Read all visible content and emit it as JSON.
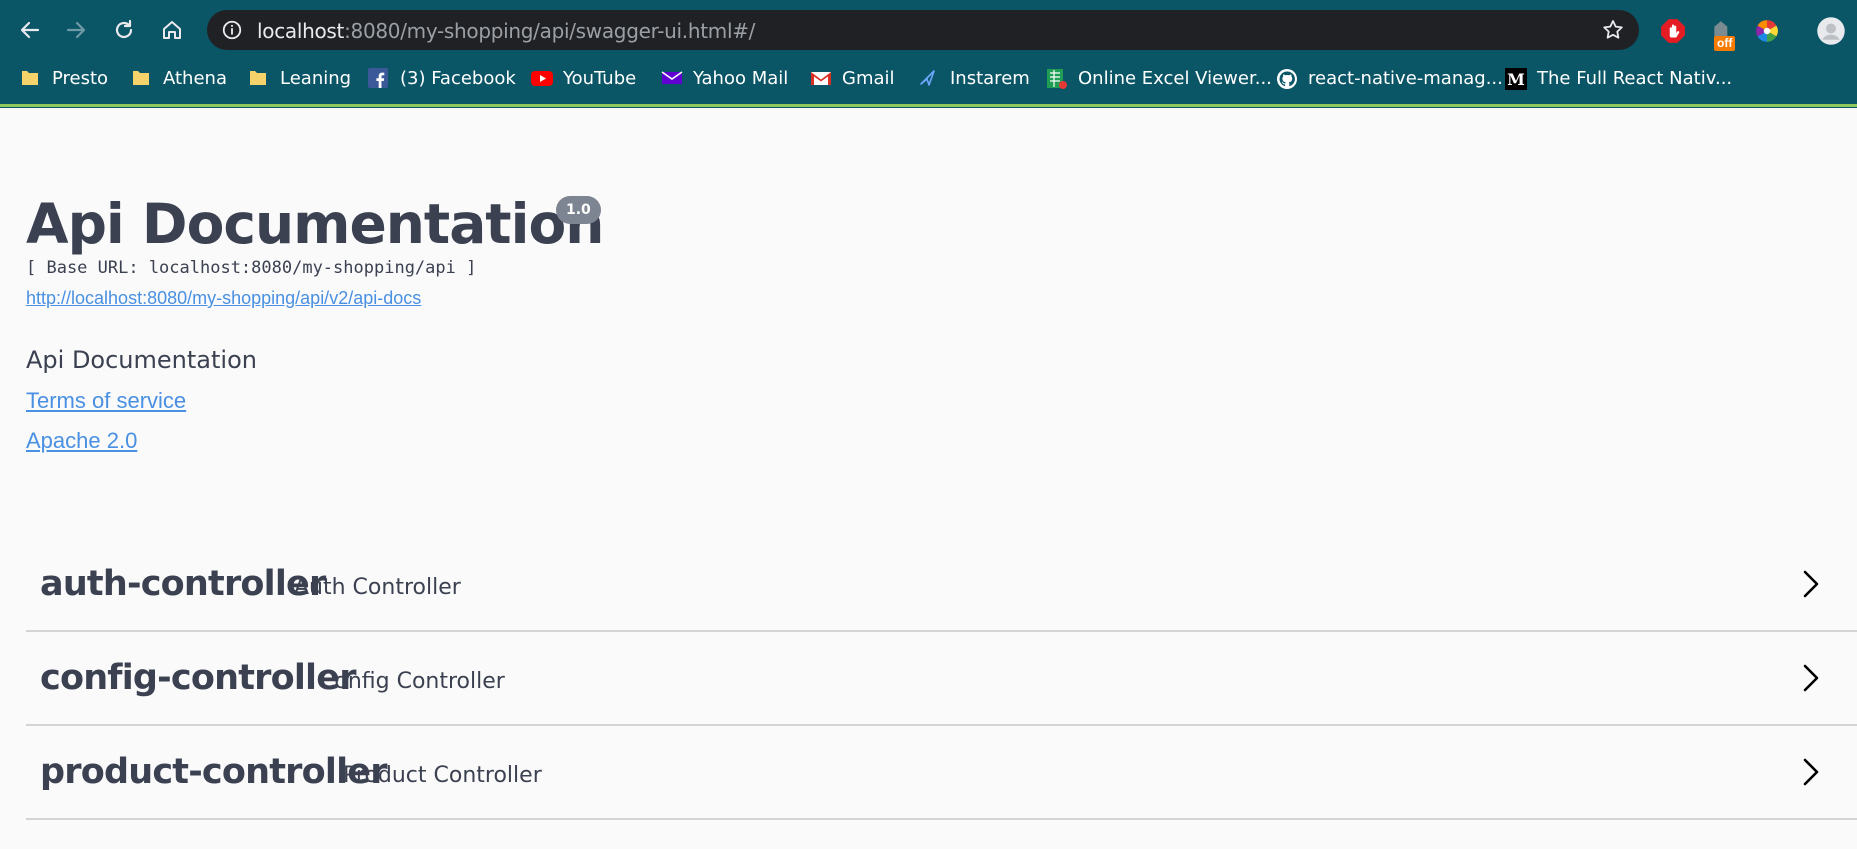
{
  "browser": {
    "url_host": "localhost",
    "url_rest": ":8080/my-shopping/api/swagger-ui.html#/",
    "extension_badge": "off",
    "bookmarks": [
      {
        "label": "Presto",
        "icon": "folder-icon"
      },
      {
        "label": "Athena",
        "icon": "folder-icon"
      },
      {
        "label": "Leaning",
        "icon": "folder-icon"
      },
      {
        "label": "(3) Facebook",
        "icon": "facebook-icon"
      },
      {
        "label": "YouTube",
        "icon": "youtube-icon"
      },
      {
        "label": "Yahoo Mail",
        "icon": "yahoo-mail-icon"
      },
      {
        "label": "Gmail",
        "icon": "gmail-icon"
      },
      {
        "label": "Instarem",
        "icon": "instarem-icon"
      },
      {
        "label": "Online Excel Viewer...",
        "icon": "excel-viewer-icon"
      },
      {
        "label": "react-native-manag...",
        "icon": "github-icon"
      },
      {
        "label": "The Full React Nativ...",
        "icon": "medium-icon"
      }
    ]
  },
  "info": {
    "title": "Api Documentation",
    "version": "1.0",
    "base_url": "[ Base URL: localhost:8080/my-shopping/api ]",
    "docs_url": "http://localhost:8080/my-shopping/api/v2/api-docs",
    "description": "Api Documentation",
    "terms": "Terms of service",
    "license": "Apache 2.0"
  },
  "tags": [
    {
      "name": "auth-controller",
      "description": "Auth Controller"
    },
    {
      "name": "config-controller",
      "description": "Config Controller"
    },
    {
      "name": "product-controller",
      "description": "Product Controller"
    }
  ],
  "colors": {
    "chrome": "#0a5566",
    "text": "#3b4151",
    "link": "#4990e2",
    "badge": "#7d8492"
  }
}
